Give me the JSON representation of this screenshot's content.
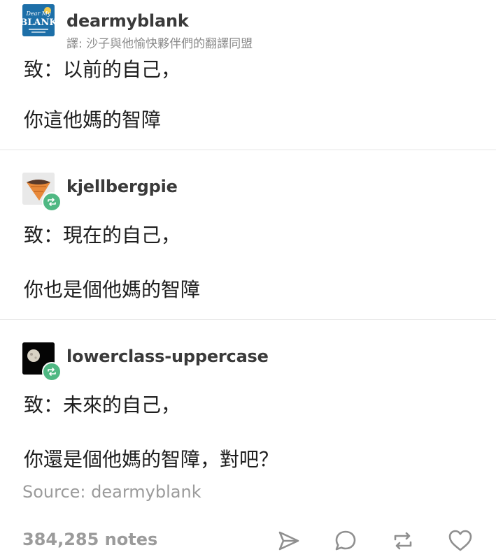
{
  "posts": [
    {
      "username": "dearmyblank",
      "subtitle": "譯: 沙子與他愉快夥伴們的翻譯同盟",
      "avatar_text": [
        "Dear My",
        "BLANK"
      ],
      "lines": [
        "致：以前的自己，",
        "你這他媽的智障"
      ]
    },
    {
      "username": "kjellbergpie",
      "lines": [
        "致：現在的自己，",
        "你也是個他媽的智障"
      ]
    },
    {
      "username": "lowerclass-uppercase",
      "lines": [
        "致：未來的自己，",
        "你還是個他媽的智障，對吧？"
      ]
    }
  ],
  "footer": {
    "source": "Source: dearmyblank",
    "notes": "384,285 notes"
  },
  "actions": [
    "send-icon",
    "comment-icon",
    "reblog-icon",
    "heart-icon"
  ],
  "colors": {
    "reblog_green": "#4fb883",
    "muted_text": "#9b9b9b",
    "avatar_blue": "#1d6fa8",
    "cone_orange": "#e8893a"
  }
}
